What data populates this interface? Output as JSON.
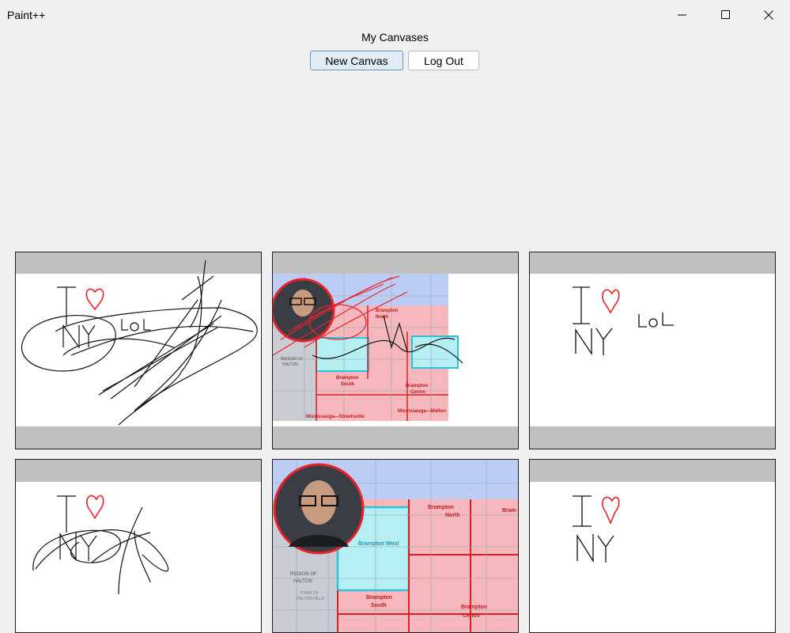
{
  "window": {
    "title": "Paint++",
    "controls": [
      "minimize-icon",
      "maximize-icon",
      "close-icon"
    ]
  },
  "page": {
    "heading": "My Canvases"
  },
  "toolbar": {
    "new_canvas_label": "New Canvas",
    "logout_label": "Log Out"
  },
  "canvases": [
    {
      "description": "Sketch: I ♥ NY LoL with black scribbles",
      "thumbnail_text": "LoL"
    },
    {
      "description": "Map overlay with portrait and red scribbles",
      "map_labels": [
        "Brampton North",
        "Brampton South",
        "Brampton Centre",
        "Mississauga—Streetsville",
        "Mississauga—Malton",
        "REGION OF HALTON"
      ]
    },
    {
      "description": "Sketch: I ♥ NY LoL",
      "thumbnail_text": "LoL"
    },
    {
      "description": "Sketch: I ♥ NY with loops"
    },
    {
      "description": "Map overlay with portrait",
      "map_labels": [
        "Brampton North",
        "Brampton West",
        "Brampton South",
        "Brampton Centre",
        "REGION OF HALTON",
        "TOWN OF HALTON HILLS"
      ]
    },
    {
      "description": "Sketch: I ♥ NY"
    }
  ],
  "colors": {
    "background": "#f0f0f0",
    "band": "#c0c0c0",
    "heart": "#e8232a",
    "primary_button_bg": "#e1ecf7",
    "primary_button_border": "#5f94c9"
  }
}
